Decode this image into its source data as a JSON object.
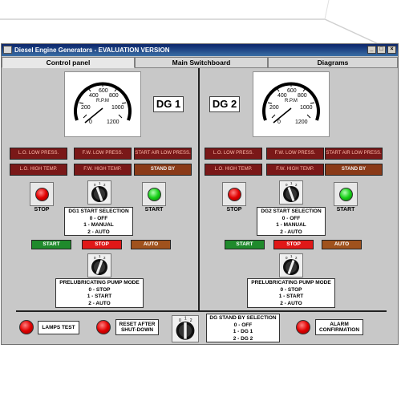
{
  "window": {
    "title": "Diesel Engine Generators  - EVALUATION VERSION"
  },
  "titlebar_buttons": {
    "minimize": "_",
    "maximize": "□",
    "close": "×"
  },
  "tabs": [
    {
      "label": "Control panel",
      "active": true
    },
    {
      "label": "Main Switchboard",
      "active": false
    },
    {
      "label": "Diagrams",
      "active": false
    }
  ],
  "gauge": {
    "unit": "R.P.M",
    "ticks": [
      "0",
      "200",
      "400",
      "600",
      "800",
      "1000",
      "1200"
    ]
  },
  "dg1": {
    "label": "DG 1",
    "alarms": [
      "L.O. LOW PRESS.",
      "F.W. LOW PRESS.",
      "START AIR LOW PRESS.",
      "L.O. HIGH TEMP.",
      "F.W. HIGH TEMP.",
      "STAND BY"
    ],
    "stop_label": "STOP",
    "start_label": "START",
    "start_selection": {
      "title": "DG1 START SELECTION",
      "options": [
        "0 - OFF",
        "1 - MANUAL",
        "2 - AUTO"
      ]
    },
    "status": [
      "START",
      "STOP",
      "AUTO"
    ]
  },
  "dg2": {
    "label": "DG 2",
    "alarms": [
      "L.O. LOW PRESS.",
      "F.W. LOW PRESS.",
      "START AIR LOW PRESS.",
      "L.O. HIGH TEMP.",
      "F.W. HIGH TEMP.",
      "STAND BY"
    ],
    "stop_label": "STOP",
    "start_label": "START",
    "start_selection": {
      "title": "DG2 START SELECTION",
      "options": [
        "0 - OFF",
        "1 - MANUAL",
        "2 - AUTO"
      ]
    },
    "status": [
      "START",
      "STOP",
      "AUTO"
    ]
  },
  "knob_marks": [
    "0",
    "1",
    "2"
  ],
  "prelub1": {
    "title": "PRELUBRICATING PUMP MODE",
    "options": [
      "0 - STOP",
      "1 - START",
      "2 - AUTO"
    ]
  },
  "prelub2": {
    "title": "PRELUBRICATING PUMP MODE",
    "options": [
      "0 - STOP",
      "1 - START",
      "2 - AUTO"
    ]
  },
  "bottom": {
    "lamps_test": "LAMPS TEST",
    "reset_after": "RESET AFTER",
    "shut_down": "SHUT-DOWN",
    "standby": {
      "title": "DG STAND BY SELECTION",
      "options": [
        "0 - OFF",
        "1 - DG 1",
        "2 - DG 2"
      ]
    },
    "alarm": "ALARM",
    "confirmation": "CONFIRMATION"
  },
  "colors": {
    "panel": "#c8c8c8",
    "alarm_red": "#7a1818",
    "alarm_brown": "#8a3a18",
    "status_green": "#1f8a2c",
    "status_red": "#e01818",
    "status_brown": "#a0521d"
  }
}
